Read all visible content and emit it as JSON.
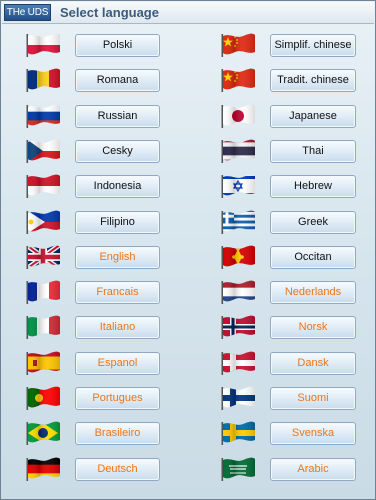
{
  "app": {
    "logo_text": "THe UDS",
    "title": "Select language"
  },
  "colors": {
    "title": "#3c5a7a",
    "unavailable_text": "#e8761b",
    "available_text": "#111111"
  },
  "left": [
    {
      "label": "Polski",
      "flag": "poland-flag-icon",
      "state": "available"
    },
    {
      "label": "Romana",
      "flag": "romania-flag-icon",
      "state": "available"
    },
    {
      "label": "Russian",
      "flag": "russia-flag-icon",
      "state": "available"
    },
    {
      "label": "Cesky",
      "flag": "czech-flag-icon",
      "state": "available"
    },
    {
      "label": "Indonesia",
      "flag": "indonesia-flag-icon",
      "state": "available"
    },
    {
      "label": "Filipino",
      "flag": "philippines-flag-icon",
      "state": "available"
    },
    {
      "label": "English",
      "flag": "uk-flag-icon",
      "state": "orange"
    },
    {
      "label": "Francais",
      "flag": "france-flag-icon",
      "state": "orange"
    },
    {
      "label": "Italiano",
      "flag": "italy-flag-icon",
      "state": "orange"
    },
    {
      "label": "Espanol",
      "flag": "spain-flag-icon",
      "state": "orange"
    },
    {
      "label": "Portugues",
      "flag": "portugal-flag-icon",
      "state": "orange"
    },
    {
      "label": "Brasileiro",
      "flag": "brazil-flag-icon",
      "state": "orange"
    },
    {
      "label": "Deutsch",
      "flag": "germany-flag-icon",
      "state": "orange"
    }
  ],
  "right": [
    {
      "label": "Simplif. chinese",
      "flag": "china-flag-icon",
      "state": "available"
    },
    {
      "label": "Tradit. chinese",
      "flag": "china-flag-icon",
      "state": "available"
    },
    {
      "label": "Japanese",
      "flag": "japan-flag-icon",
      "state": "available"
    },
    {
      "label": "Thai",
      "flag": "thailand-flag-icon",
      "state": "available"
    },
    {
      "label": "Hebrew",
      "flag": "israel-flag-icon",
      "state": "available"
    },
    {
      "label": "Greek",
      "flag": "greece-flag-icon",
      "state": "available"
    },
    {
      "label": "Occitan",
      "flag": "occitania-flag-icon",
      "state": "available"
    },
    {
      "label": "Nederlands",
      "flag": "netherlands-flag-icon",
      "state": "orange"
    },
    {
      "label": "Norsk",
      "flag": "norway-flag-icon",
      "state": "orange"
    },
    {
      "label": "Dansk",
      "flag": "denmark-flag-icon",
      "state": "orange"
    },
    {
      "label": "Suomi",
      "flag": "finland-flag-icon",
      "state": "orange"
    },
    {
      "label": "Svenska",
      "flag": "sweden-flag-icon",
      "state": "orange"
    },
    {
      "label": "Arabic",
      "flag": "saudi-flag-icon",
      "state": "orange"
    }
  ]
}
